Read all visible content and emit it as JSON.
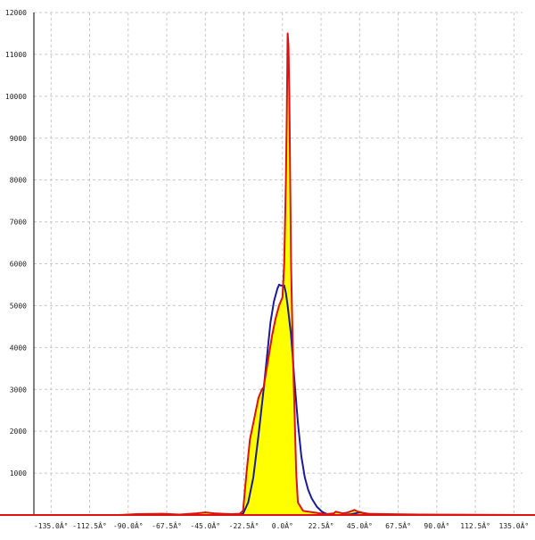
{
  "chart_data": {
    "type": "area",
    "title": "",
    "xlabel": "",
    "ylabel": "",
    "xlim": [
      -145,
      140
    ],
    "ylim": [
      0,
      12000
    ],
    "grid": true,
    "x_ticks": [
      {
        "value": -135,
        "label": "-135.0Â°"
      },
      {
        "value": -112.5,
        "label": "-112.5Â°"
      },
      {
        "value": -90,
        "label": "-90.0Â°"
      },
      {
        "value": -67.5,
        "label": "-67.5Â°"
      },
      {
        "value": -45,
        "label": "-45.0Â°"
      },
      {
        "value": -22.5,
        "label": "-22.5Â°"
      },
      {
        "value": 0,
        "label": "0.0Â°"
      },
      {
        "value": 22.5,
        "label": "22.5Â°"
      },
      {
        "value": 45,
        "label": "45.0Â°"
      },
      {
        "value": 67.5,
        "label": "67.5Â°"
      },
      {
        "value": 90,
        "label": "90.0Â°"
      },
      {
        "value": 112.5,
        "label": "112.5Â°"
      },
      {
        "value": 135,
        "label": "135.0Â°"
      }
    ],
    "y_ticks": [
      {
        "value": 1000,
        "label": "1000"
      },
      {
        "value": 2000,
        "label": "2000"
      },
      {
        "value": 3000,
        "label": "3000"
      },
      {
        "value": 4000,
        "label": "4000"
      },
      {
        "value": 5000,
        "label": "5000"
      },
      {
        "value": 6000,
        "label": "6000"
      },
      {
        "value": 7000,
        "label": "7000"
      },
      {
        "value": 8000,
        "label": "8000"
      },
      {
        "value": 9000,
        "label": "9000"
      },
      {
        "value": 10000,
        "label": "10000"
      },
      {
        "value": 11000,
        "label": "11000"
      },
      {
        "value": 12000,
        "label": "12000"
      }
    ],
    "series": [
      {
        "color": "#dd1111",
        "fill": "#ffff00",
        "x": [
          -145,
          -95,
          -85,
          -70,
          -60,
          -50,
          -45,
          -40,
          -30,
          -25,
          -23,
          -21,
          -19,
          -16,
          -14,
          -12,
          -11,
          -10,
          -8,
          -6,
          -4,
          -2,
          0,
          1,
          2,
          2.5,
          3,
          3.5,
          4,
          4.5,
          5,
          6,
          7,
          8,
          9,
          12,
          20,
          25,
          30,
          31,
          33,
          35,
          38,
          40,
          42,
          44,
          47,
          50,
          60,
          80,
          140
        ],
        "y": [
          0,
          0,
          20,
          30,
          10,
          40,
          60,
          40,
          20,
          30,
          100,
          1000,
          1800,
          2400,
          2800,
          3000,
          3050,
          3300,
          3800,
          4300,
          4700,
          5000,
          5200,
          6000,
          8000,
          9500,
          11500,
          11200,
          10000,
          8000,
          6000,
          4000,
          2500,
          1000,
          300,
          100,
          50,
          20,
          40,
          80,
          60,
          40,
          60,
          90,
          120,
          80,
          50,
          30,
          20,
          10,
          0
        ]
      },
      {
        "color": "#1a1a9a",
        "x": [
          -145,
          -95,
          -40,
          -30,
          -25,
          -23,
          -20,
          -17,
          -14,
          -11,
          -9,
          -7,
          -5,
          -3,
          -2,
          -1,
          0,
          1,
          2,
          3,
          5,
          7,
          9,
          11,
          13,
          15,
          17,
          20,
          23,
          26,
          30,
          35,
          40,
          45,
          48,
          55,
          140
        ],
        "y": [
          0,
          0,
          0,
          0,
          0,
          30,
          300,
          900,
          1900,
          3000,
          3800,
          4600,
          5100,
          5400,
          5500,
          5480,
          5480,
          5480,
          5300,
          5000,
          4300,
          3200,
          2200,
          1400,
          900,
          600,
          400,
          200,
          80,
          20,
          0,
          0,
          20,
          60,
          40,
          0,
          0
        ]
      }
    ]
  }
}
